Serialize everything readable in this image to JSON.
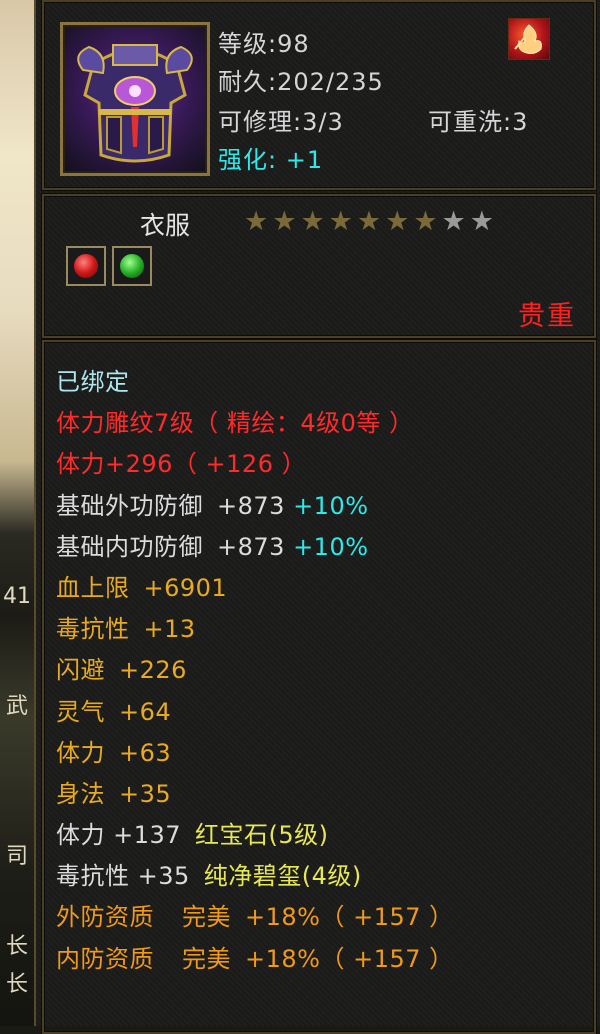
{
  "background_fragments": [
    "41",
    "武",
    "司",
    "长",
    "长"
  ],
  "item": {
    "level": "等级:98",
    "durability": "耐久:202/235",
    "repairable": "可修理:3/3",
    "rewash": "可重洗:3",
    "enhance_label": "强化:",
    "enhance_value": "+1",
    "type": "衣服",
    "stars": {
      "filled": 7,
      "total": 9
    },
    "rarity": "贵重",
    "sockets": [
      "red-gem",
      "green-gem"
    ]
  },
  "attributes": {
    "bound": "已绑定",
    "engrave": "体力雕纹7级（ 精绘：4级0等 ）",
    "stamina_main": "体力+296（ +126 ）",
    "ext_def_label": "基础外功防御",
    "ext_def_value": "+873",
    "ext_def_pct": "+10%",
    "int_def_label": "基础内功防御",
    "int_def_value": "+873",
    "int_def_pct": "+10%",
    "hp_label": "血上限",
    "hp_value": "+6901",
    "poison_label": "毒抗性",
    "poison_value": "+13",
    "dodge_label": "闪避",
    "dodge_value": "+226",
    "spirit_label": "灵气",
    "spirit_value": "+64",
    "stamina_label": "体力",
    "stamina_value": "+63",
    "agility_label": "身法",
    "agility_value": "+35",
    "gem1_stat": "体力 +137",
    "gem1_name": "红宝石(5级)",
    "gem2_stat": "毒抗性 +35",
    "gem2_name": "纯净碧玺(4级)",
    "qual1_label": "外防资质",
    "qual1_grade": "完美",
    "qual1_value": "+18%（ +157 ）",
    "qual2_label": "内防资质",
    "qual2_grade": "完美",
    "qual2_value": "+18%（ +157 ）"
  },
  "colors": {
    "bound": "#aee6ef",
    "red": "#ff2a2a",
    "cyan": "#2fe8e8",
    "gold": "#e8aa22",
    "yellow": "#e8e855",
    "orange": "#f09a1c"
  }
}
